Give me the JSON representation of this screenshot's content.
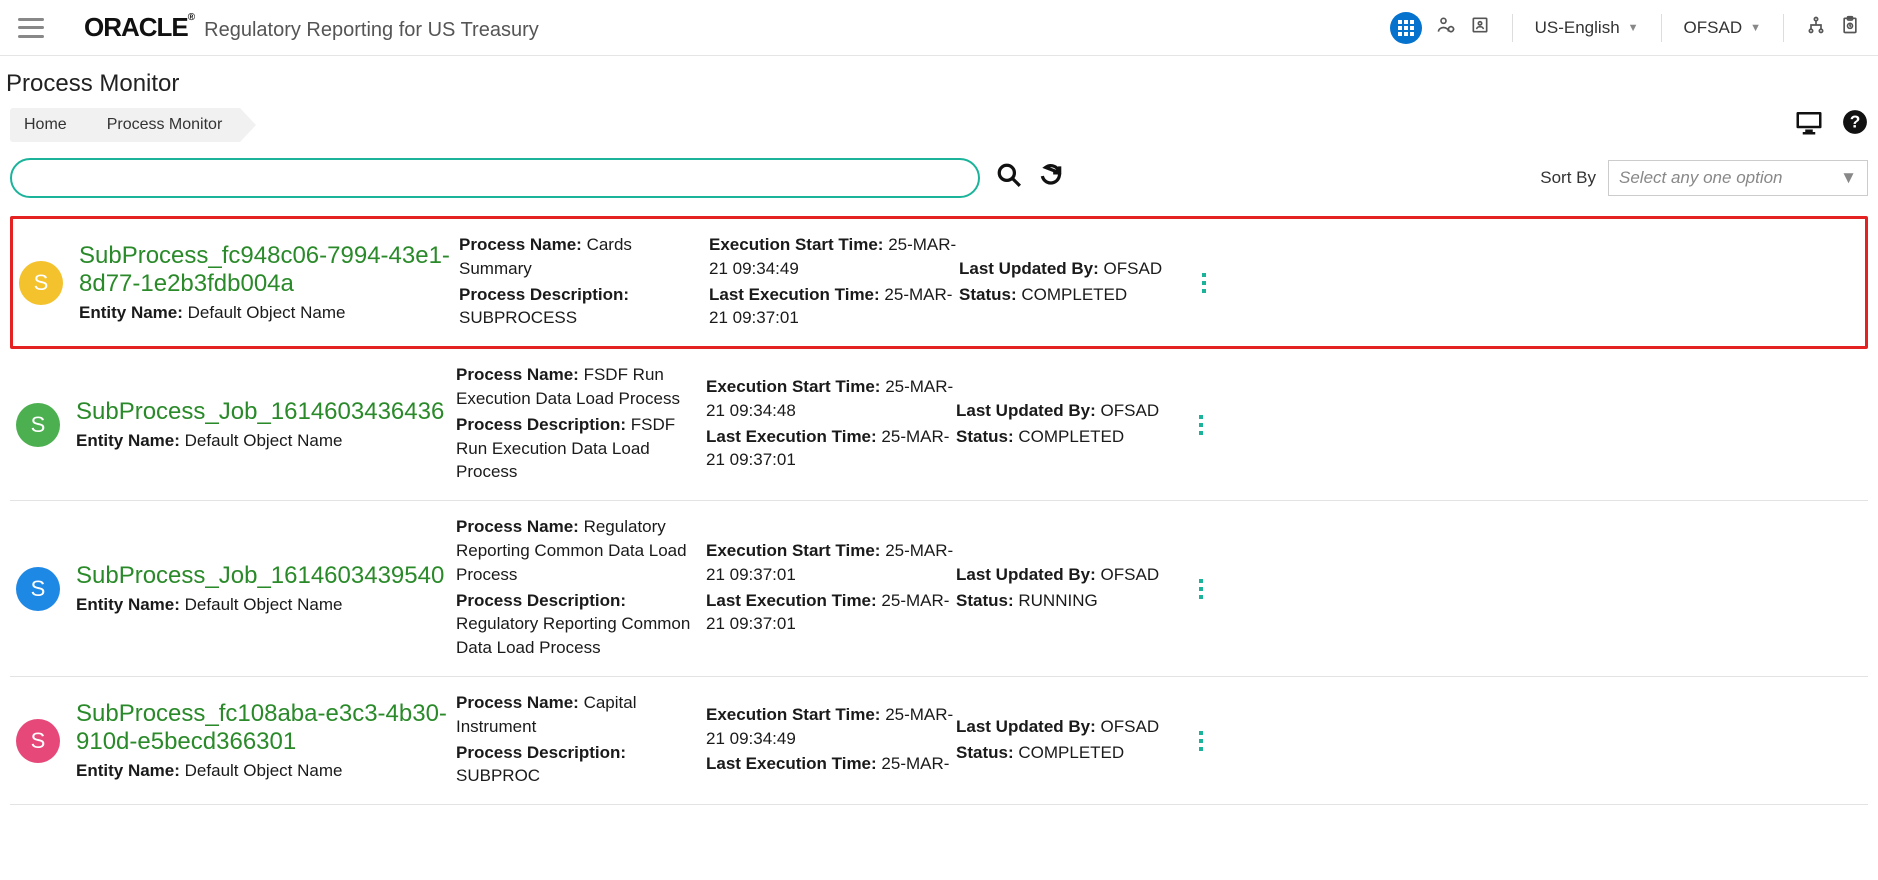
{
  "header": {
    "logo": "ORACLE",
    "product": "Regulatory Reporting for US Treasury",
    "language": "US-English",
    "user": "OFSAD"
  },
  "page": {
    "title": "Process Monitor",
    "breadcrumbs": [
      "Home",
      "Process Monitor"
    ],
    "sort_label": "Sort By",
    "sort_placeholder": "Select any one option"
  },
  "labels": {
    "entity": "Entity Name:",
    "proc_name": "Process Name:",
    "proc_desc": "Process Description:",
    "exec_start": "Execution Start Time:",
    "last_exec": "Last Execution Time:",
    "last_upd": "Last Updated By:",
    "status": "Status:"
  },
  "rows": [
    {
      "badge": "S",
      "badge_color": "#f3c22c",
      "highlight": true,
      "title": "SubProcess_fc948c06-7994-43e1-8d77-1e2b3fdb004a",
      "entity": "Default Object Name",
      "proc_name": "Cards Summary",
      "proc_desc": "SUBPROCESS",
      "exec_start": "25-MAR-21 09:34:49",
      "last_exec": "25-MAR-21 09:37:01",
      "last_upd": "OFSAD",
      "status": "COMPLETED"
    },
    {
      "badge": "S",
      "badge_color": "#4caf50",
      "highlight": false,
      "title": "SubProcess_Job_1614603436436",
      "entity": "Default Object Name",
      "proc_name": "FSDF Run Execution Data Load Process",
      "proc_desc": "FSDF Run Execution Data Load Process",
      "exec_start": "25-MAR-21 09:34:48",
      "last_exec": "25-MAR-21 09:37:01",
      "last_upd": "OFSAD",
      "status": "COMPLETED"
    },
    {
      "badge": "S",
      "badge_color": "#1e88e5",
      "highlight": false,
      "title": "SubProcess_Job_1614603439540",
      "entity": "Default Object Name",
      "proc_name": "Regulatory Reporting Common Data Load Process",
      "proc_desc": "Regulatory Reporting Common Data Load Process",
      "exec_start": "25-MAR-21 09:37:01",
      "last_exec": "25-MAR-21 09:37:01",
      "last_upd": "OFSAD",
      "status": "RUNNING"
    },
    {
      "badge": "S",
      "badge_color": "#e6487a",
      "highlight": false,
      "title": "SubProcess_fc108aba-e3c3-4b30-910d-e5becd366301",
      "entity": "Default Object Name",
      "proc_name": "Capital Instrument",
      "proc_desc": "SUBPROC",
      "exec_start": "25-MAR-21 09:34:49",
      "last_exec": "25-MAR-",
      "last_upd": "OFSAD",
      "status": "COMPLETED"
    }
  ]
}
